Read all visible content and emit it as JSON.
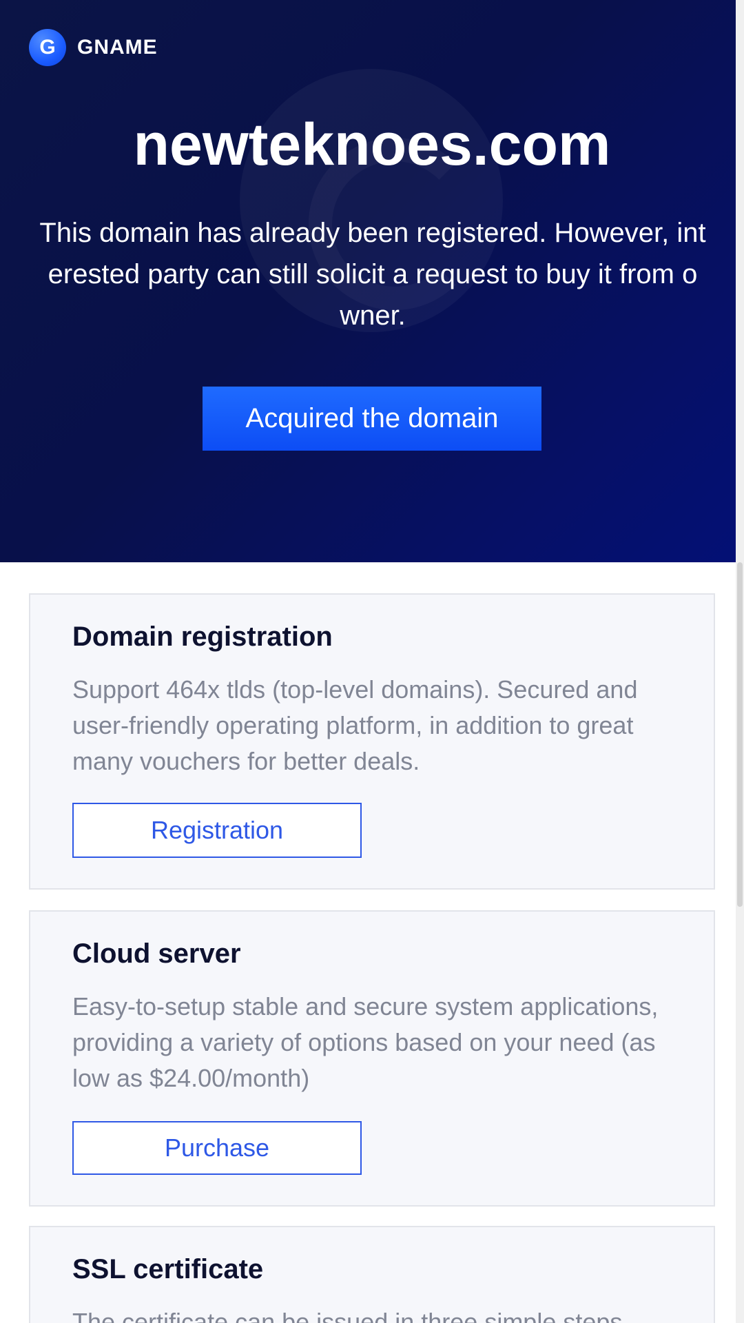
{
  "brand": {
    "logo_letter": "G",
    "name": "GNAME"
  },
  "hero": {
    "domain": "newteknoes.com",
    "description": "This domain has already been registered. However, interested party can still solicit a request to buy it from owner.",
    "button_label": "Acquired the domain"
  },
  "cards": [
    {
      "title": "Domain registration",
      "description": "Support 464x tlds (top-level domains). Secured and user-friendly operating platform, in addition to great many vouchers for better deals.",
      "button_label": "Registration"
    },
    {
      "title": "Cloud server",
      "description": "Easy-to-setup stable and secure system applications, providing a variety of options based on your need (as low as $24.00/month)",
      "button_label": "Purchase"
    },
    {
      "title": "SSL certificate",
      "description": "The certificate can be issued in three simple steps"
    }
  ],
  "colors": {
    "hero_bg": "#08104a",
    "accent": "#1f6bff",
    "card_bg": "#f6f7fb",
    "card_button": "#2e58e6"
  },
  "icons": {
    "logo": "gname-logo-icon"
  }
}
